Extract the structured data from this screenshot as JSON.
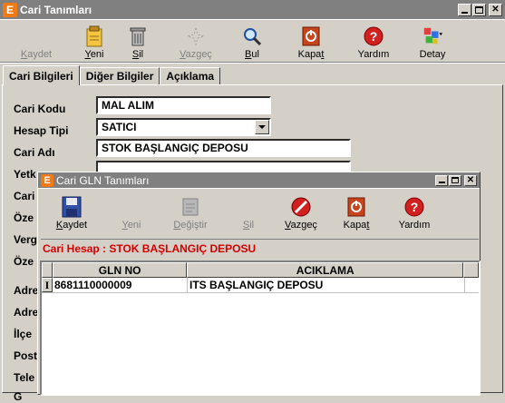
{
  "window": {
    "title": "Cari Tanımları",
    "app_icon": "E"
  },
  "toolbar": {
    "items": [
      {
        "label_pre": "",
        "label_u": "K",
        "label_post": "aydet",
        "icon": "save-icon",
        "enabled": false
      },
      {
        "label_pre": "",
        "label_u": "Y",
        "label_post": "eni",
        "icon": "new-document-icon",
        "enabled": true
      },
      {
        "label_pre": "",
        "label_u": "S",
        "label_post": "il",
        "icon": "trash-icon",
        "enabled": true
      },
      {
        "label_pre": "",
        "label_u": "V",
        "label_post": "azgeç",
        "icon": "cancel-icon",
        "enabled": false
      },
      {
        "label_pre": "",
        "label_u": "B",
        "label_post": "ul",
        "icon": "search-icon",
        "enabled": true
      },
      {
        "label_pre": "Kapa",
        "label_u": "t",
        "label_post": "",
        "icon": "close-door-icon",
        "enabled": true
      },
      {
        "label_pre": "Yardım",
        "label_u": "",
        "label_post": "",
        "icon": "help-icon",
        "enabled": true
      },
      {
        "label_pre": "Detay",
        "label_u": "",
        "label_post": "",
        "icon": "detail-icon",
        "enabled": true
      }
    ]
  },
  "tabs": [
    "Cari Bilgileri",
    "Diğer Bilgiler",
    "Açıklama"
  ],
  "form": {
    "labels": [
      "Cari Kodu",
      "Hesap Tipi",
      "Cari Adı",
      "Yetk",
      "Cari",
      "Öze",
      "Verg",
      "Öze",
      "Adre",
      "Adre",
      "İlçe",
      "Post",
      "Tele",
      "G"
    ],
    "cari_kodu": "MAL ALIM",
    "hesap_tipi": "SATICI",
    "cari_adi": "STOK BAŞLANGIÇ DEPOSU"
  },
  "dialog": {
    "title": "Cari GLN Tanımları",
    "app_icon": "E",
    "toolbar": [
      {
        "label_pre": "",
        "label_u": "K",
        "label_post": "aydet",
        "icon": "save-icon",
        "enabled": true
      },
      {
        "label_pre": "",
        "label_u": "Y",
        "label_post": "eni",
        "icon": "new-icon",
        "enabled": false
      },
      {
        "label_pre": "",
        "label_u": "D",
        "label_post": "eğiştir",
        "icon": "edit-icon",
        "enabled": false
      },
      {
        "label_pre": "",
        "label_u": "S",
        "label_post": "il",
        "icon": "delete-icon",
        "enabled": false
      },
      {
        "label_pre": "",
        "label_u": "V",
        "label_post": "azgeç",
        "icon": "cancel-icon",
        "enabled": true
      },
      {
        "label_pre": "Kapa",
        "label_u": "t",
        "label_post": "",
        "icon": "close-door-icon",
        "enabled": true
      },
      {
        "label_pre": "Yardım",
        "label_u": "",
        "label_post": "",
        "icon": "help-icon",
        "enabled": true
      }
    ],
    "cari_hesap": "Cari Hesap : STOK BAŞLANGIÇ DEPOSU",
    "grid": {
      "columns": [
        "GLN NO",
        "ACIKLAMA"
      ],
      "rows": [
        {
          "indicator": "I",
          "gln_no": "8681110000009",
          "aciklama": "ITS BAŞLANGIÇ DEPOSU"
        }
      ]
    }
  },
  "colors": {
    "face": "#d4d0c8",
    "titlebar_inactive": "#808080",
    "app_icon": "#f07a16",
    "cari_hesap_text": "#d40000"
  }
}
